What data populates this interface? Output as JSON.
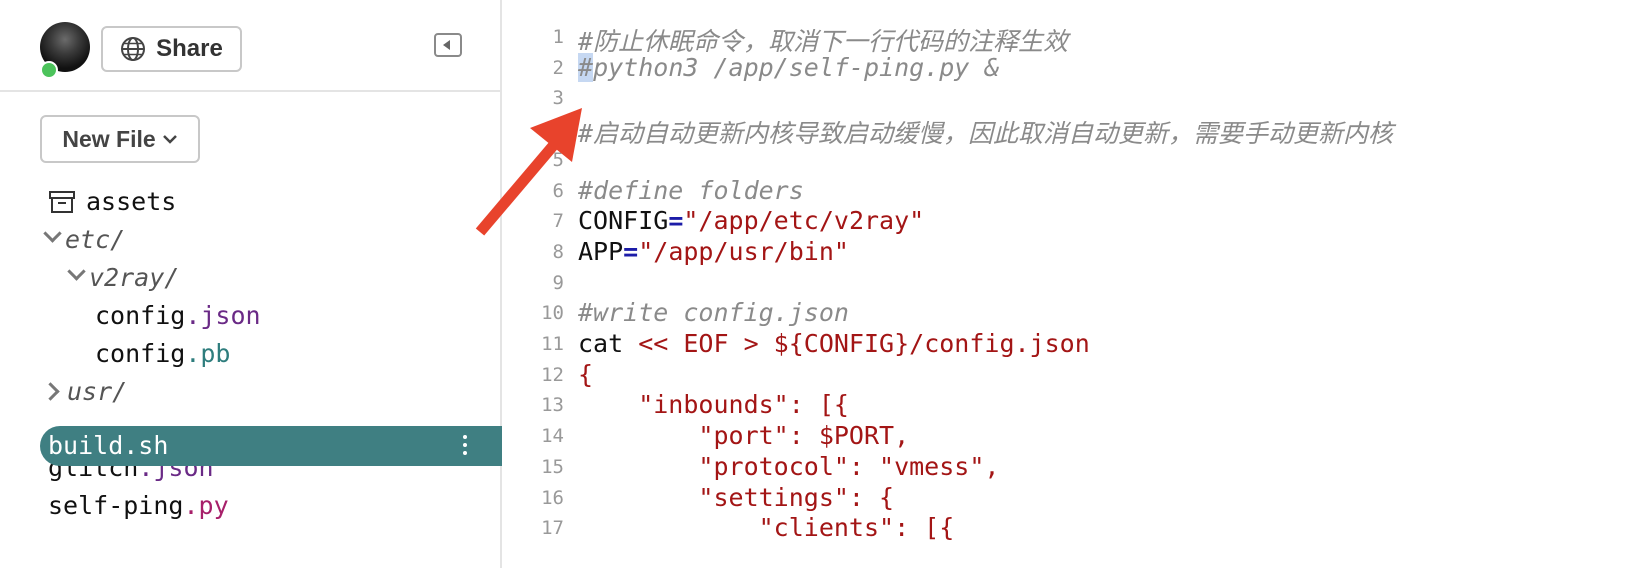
{
  "topbar": {
    "share_label": "Share",
    "collapse_icon": "sidebar-collapse-icon"
  },
  "new_file_label": "New File",
  "tree": [
    {
      "name": "assets",
      "ext": "",
      "type": "assets",
      "indent": 0
    },
    {
      "name": "etc/",
      "ext": "",
      "type": "folder-open",
      "indent": 0
    },
    {
      "name": "v2ray/",
      "ext": "",
      "type": "folder-open",
      "indent": 1
    },
    {
      "name": "config",
      "ext": ".json",
      "type": "file",
      "indent": 2
    },
    {
      "name": "config",
      "ext": ".pb",
      "type": "file",
      "indent": 2
    },
    {
      "name": "usr/",
      "ext": "",
      "type": "folder-closed",
      "indent": 0
    },
    {
      "name": "build.sh",
      "ext": "",
      "type": "file-active",
      "indent": 0
    },
    {
      "name": "glitch",
      "ext": ".json",
      "type": "file",
      "indent": 0
    },
    {
      "name": "self-ping",
      "ext": ".py",
      "type": "file",
      "indent": 0
    }
  ],
  "editor": {
    "lines": [
      {
        "n": "1",
        "html": "<span class='c-com'>#防止休眠命令，取消下一行代码的注释生效</span>"
      },
      {
        "n": "2",
        "html": "<span class='c-com'><span class='sel'>#</span>python3 /app/self-ping.py &amp;</span>"
      },
      {
        "n": "3",
        "html": ""
      },
      {
        "n": "4",
        "html": "<span class='c-com'>#启动自动更新内核导致启动缓慢，因此取消自动更新，需要手动更新内核</span>"
      },
      {
        "n": "5",
        "html": ""
      },
      {
        "n": "6",
        "html": "<span class='c-com'>#define folders</span>"
      },
      {
        "n": "7",
        "html": "CONFIG<span class='c-op'>=</span><span class='c-str'>\"/app/etc/v2ray\"</span>"
      },
      {
        "n": "8",
        "html": "APP<span class='c-op'>=</span><span class='c-str'>\"/app/usr/bin\"</span>"
      },
      {
        "n": "9",
        "html": ""
      },
      {
        "n": "10",
        "html": "<span class='c-com'>#write config.json</span>"
      },
      {
        "n": "11",
        "html": "cat <span class='c-str'>&lt;&lt; EOF &gt; ${CONFIG}/config.json</span>"
      },
      {
        "n": "12",
        "html": "<span class='c-str'>{</span>"
      },
      {
        "n": "13",
        "html": "<span class='c-str'>    \"inbounds\": [{</span>"
      },
      {
        "n": "14",
        "html": "<span class='c-str'>        \"port\": $PORT,</span>"
      },
      {
        "n": "15",
        "html": "<span class='c-str'>        \"protocol\": \"vmess\",</span>"
      },
      {
        "n": "16",
        "html": "<span class='c-str'>        \"settings\": {</span>"
      },
      {
        "n": "17",
        "html": "<span class='c-str'>            \"clients\": [{</span>"
      }
    ]
  },
  "colors": {
    "active_row": "#3f7f82",
    "arrow": "#e8432c",
    "online": "#4cc35b"
  }
}
